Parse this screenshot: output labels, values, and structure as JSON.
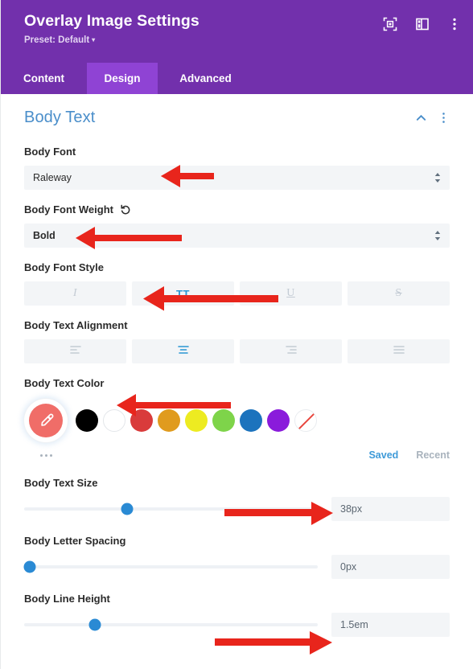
{
  "header": {
    "title": "Overlay Image Settings",
    "preset_label": "Preset: Default",
    "preset_caret": "▾",
    "icons": [
      {
        "name": "focus-icon"
      },
      {
        "name": "layout-panel-icon"
      },
      {
        "name": "more-vertical-icon"
      }
    ]
  },
  "tabs": [
    {
      "label": "Content",
      "active": false
    },
    {
      "label": "Design",
      "active": true
    },
    {
      "label": "Advanced",
      "active": false
    }
  ],
  "section": {
    "title": "Body Text",
    "collapse_icon": "chevron-up-icon",
    "menu_icon": "more-vertical-icon"
  },
  "fields": {
    "body_font": {
      "label": "Body Font",
      "value": "Raleway"
    },
    "body_font_weight": {
      "label": "Body Font Weight",
      "value": "Bold",
      "reset_icon": "reset-icon"
    },
    "body_font_style": {
      "label": "Body Font Style",
      "options": [
        {
          "label": "I",
          "name": "italic",
          "active": false
        },
        {
          "label": "TT",
          "name": "uppercase",
          "active": true
        },
        {
          "label": "U",
          "name": "underline",
          "active": false
        },
        {
          "label": "S",
          "name": "strikethrough",
          "active": false
        }
      ]
    },
    "body_text_alignment": {
      "label": "Body Text Alignment",
      "options": [
        {
          "name": "align-left",
          "active": false
        },
        {
          "name": "align-center",
          "active": true
        },
        {
          "name": "align-right",
          "active": false
        },
        {
          "name": "align-justify",
          "active": false
        }
      ]
    },
    "body_text_color": {
      "label": "Body Text Color",
      "selected_swatch": "#f06d68",
      "swatches": [
        {
          "name": "black",
          "color": "#000000"
        },
        {
          "name": "white",
          "color": "#ffffff"
        },
        {
          "name": "red",
          "color": "#d93b3b"
        },
        {
          "name": "orange",
          "color": "#e09b1e"
        },
        {
          "name": "yellow",
          "color": "#edeb21"
        },
        {
          "name": "green",
          "color": "#7ed44a"
        },
        {
          "name": "blue",
          "color": "#1c73bd"
        },
        {
          "name": "purple",
          "color": "#8a1bdb"
        },
        {
          "name": "none",
          "color": "transparent"
        }
      ],
      "saved_label": "Saved",
      "recent_label": "Recent"
    },
    "body_text_size": {
      "label": "Body Text Size",
      "value": "38px",
      "handle_percent": 35
    },
    "body_letter_spacing": {
      "label": "Body Letter Spacing",
      "value": "0px",
      "handle_percent": 2
    },
    "body_line_height": {
      "label": "Body Line Height",
      "value": "1.5em",
      "handle_percent": 24
    }
  },
  "colors": {
    "header_purple": "#7230ac",
    "tab_active_purple": "#8f43d4",
    "section_blue": "#4a8eca",
    "accent_blue": "#2a8ad4",
    "annotation_red": "#e8251c"
  }
}
